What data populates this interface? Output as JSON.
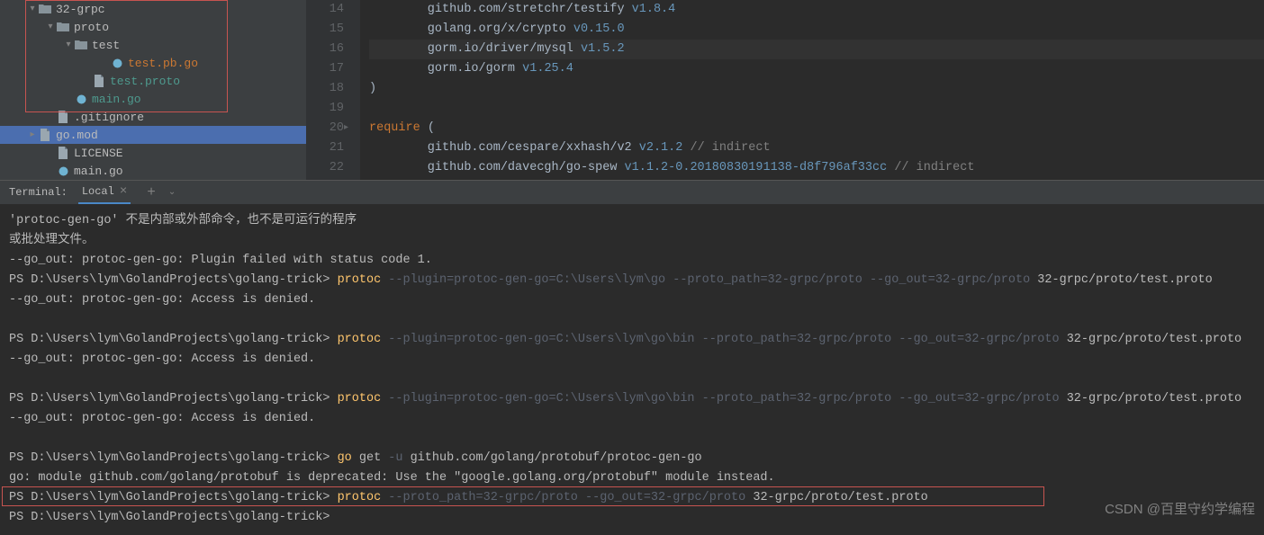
{
  "sidebar": {
    "items": [
      {
        "indent": 30,
        "arrow": "▾",
        "icon": "folder",
        "label": "32-grpc",
        "cls": ""
      },
      {
        "indent": 50,
        "arrow": "▾",
        "icon": "folder",
        "label": "proto",
        "cls": ""
      },
      {
        "indent": 70,
        "arrow": "▾",
        "icon": "folder",
        "label": "test",
        "cls": ""
      },
      {
        "indent": 110,
        "arrow": "",
        "icon": "go",
        "label": "test.pb.go",
        "cls": "orange"
      },
      {
        "indent": 90,
        "arrow": "",
        "icon": "proto",
        "label": "test.proto",
        "cls": "teal"
      },
      {
        "indent": 70,
        "arrow": "",
        "icon": "go",
        "label": "main.go",
        "cls": "teal"
      },
      {
        "indent": 50,
        "arrow": "",
        "icon": "proto",
        "label": ".gitignore",
        "cls": ""
      },
      {
        "indent": 30,
        "arrow": "▸",
        "icon": "proto",
        "label": "go.mod",
        "cls": ""
      },
      {
        "indent": 50,
        "arrow": "",
        "icon": "proto",
        "label": "LICENSE",
        "cls": ""
      },
      {
        "indent": 50,
        "arrow": "",
        "icon": "go",
        "label": "main.go",
        "cls": ""
      }
    ]
  },
  "editor": {
    "lines": [
      {
        "n": "14",
        "html": "        github.com/stretchr/testify |v1.8.4"
      },
      {
        "n": "15",
        "html": "        golang.org/x/crypto |v0.15.0"
      },
      {
        "n": "16",
        "html": "        gorm.io/driver/mysql |v1.5.2",
        "hl": true
      },
      {
        "n": "17",
        "html": "        gorm.io/gorm |v1.25.4"
      },
      {
        "n": "18",
        "html": ")"
      },
      {
        "n": "19",
        "html": ""
      },
      {
        "n": "20",
        "html": "~require~ (",
        "fold": true
      },
      {
        "n": "21",
        "html": "        github.com/cespare/xxhash/v2 |v2.1.2 #// indirect"
      },
      {
        "n": "22",
        "html": "        github.com/davecgh/go-spew |v1.1.2-0.20180830191138-d8f796af33cc #// indirect"
      }
    ]
  },
  "terminal": {
    "header_label": "Terminal:",
    "tab": "Local",
    "lines": [
      {
        "t": "'protoc-gen-go' 不是内部或外部命令，也不是可运行的程序"
      },
      {
        "t": "或批处理文件。"
      },
      {
        "t": "--go_out: protoc-gen-go: Plugin failed with status code 1."
      },
      {
        "pre": "PS D:\\Users\\lym\\GolandProjects\\golang-trick> ",
        "cmd": "protoc",
        "grey": " --plugin=protoc-gen-go=C:\\Users\\lym\\go --proto_path=32-grpc/proto --go_out=32-grpc/proto",
        "suf": " 32-grpc/proto/test.proto"
      },
      {
        "t": "--go_out: protoc-gen-go: Access is denied."
      },
      {
        "t": " "
      },
      {
        "pre": "PS D:\\Users\\lym\\GolandProjects\\golang-trick> ",
        "cmd": "protoc",
        "grey": " --plugin=protoc-gen-go=C:\\Users\\lym\\go\\bin --proto_path=32-grpc/proto --go_out=32-grpc/proto",
        "suf": " 32-grpc/proto/test.proto"
      },
      {
        "t": "--go_out: protoc-gen-go: Access is denied."
      },
      {
        "t": " "
      },
      {
        "pre": "PS D:\\Users\\lym\\GolandProjects\\golang-trick> ",
        "cmd": "protoc",
        "grey": " --plugin=protoc-gen-go=C:\\Users\\lym\\go\\bin --proto_path=32-grpc/proto --go_out=32-grpc/proto",
        "suf": " 32-grpc/proto/test.proto"
      },
      {
        "t": "--go_out: protoc-gen-go: Access is denied."
      },
      {
        "t": " "
      },
      {
        "pre": "PS D:\\Users\\lym\\GolandProjects\\golang-trick> ",
        "cmd": "go",
        "suf2": " get ",
        "grey": "-u",
        "suf": " github.com/golang/protobuf/protoc-gen-go"
      },
      {
        "t": "go: module github.com/golang/protobuf is deprecated: Use the \"google.golang.org/protobuf\" module instead."
      },
      {
        "pre": "PS D:\\Users\\lym\\GolandProjects\\golang-trick> ",
        "cmd": "protoc",
        "grey": " --proto_path=32-grpc/proto --go_out=32-grpc/proto",
        "suf": " 32-grpc/proto/test.proto",
        "box": true
      },
      {
        "t": "PS D:\\Users\\lym\\GolandProjects\\golang-trick>"
      }
    ]
  },
  "watermark": "CSDN @百里守约学编程"
}
